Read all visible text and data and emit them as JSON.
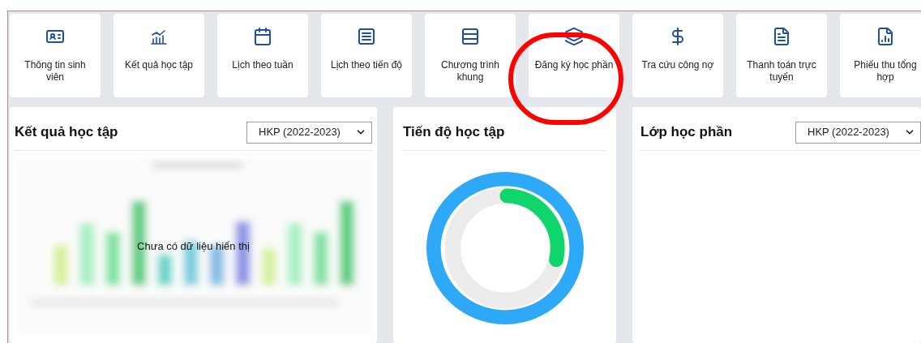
{
  "menu": [
    {
      "label": "Thông tin sinh viên",
      "highlighted": false
    },
    {
      "label": "Kết quả học tập",
      "highlighted": false
    },
    {
      "label": "Lịch theo tuần",
      "highlighted": false
    },
    {
      "label": "Lịch theo tiến độ",
      "highlighted": false
    },
    {
      "label": "Chương trình khung",
      "highlighted": false
    },
    {
      "label": "Đăng ký học phần",
      "highlighted": true
    },
    {
      "label": "Tra cứu công nợ",
      "highlighted": false
    },
    {
      "label": "Thanh toán trực tuyến",
      "highlighted": false
    },
    {
      "label": "Phiếu thu tổng hợp",
      "highlighted": false
    }
  ],
  "results_panel": {
    "title": "Kết quả học tập",
    "semester_select": {
      "value": "HKP (2022-2023)"
    },
    "empty_message": "Chưa có dữ liệu hiển thị"
  },
  "progress_panel": {
    "title": "Tiến độ học tập",
    "level": 0.28
  },
  "classes_panel": {
    "title": "Lớp học phần",
    "semester_select": {
      "value": "HKP (2022-2023)"
    }
  }
}
